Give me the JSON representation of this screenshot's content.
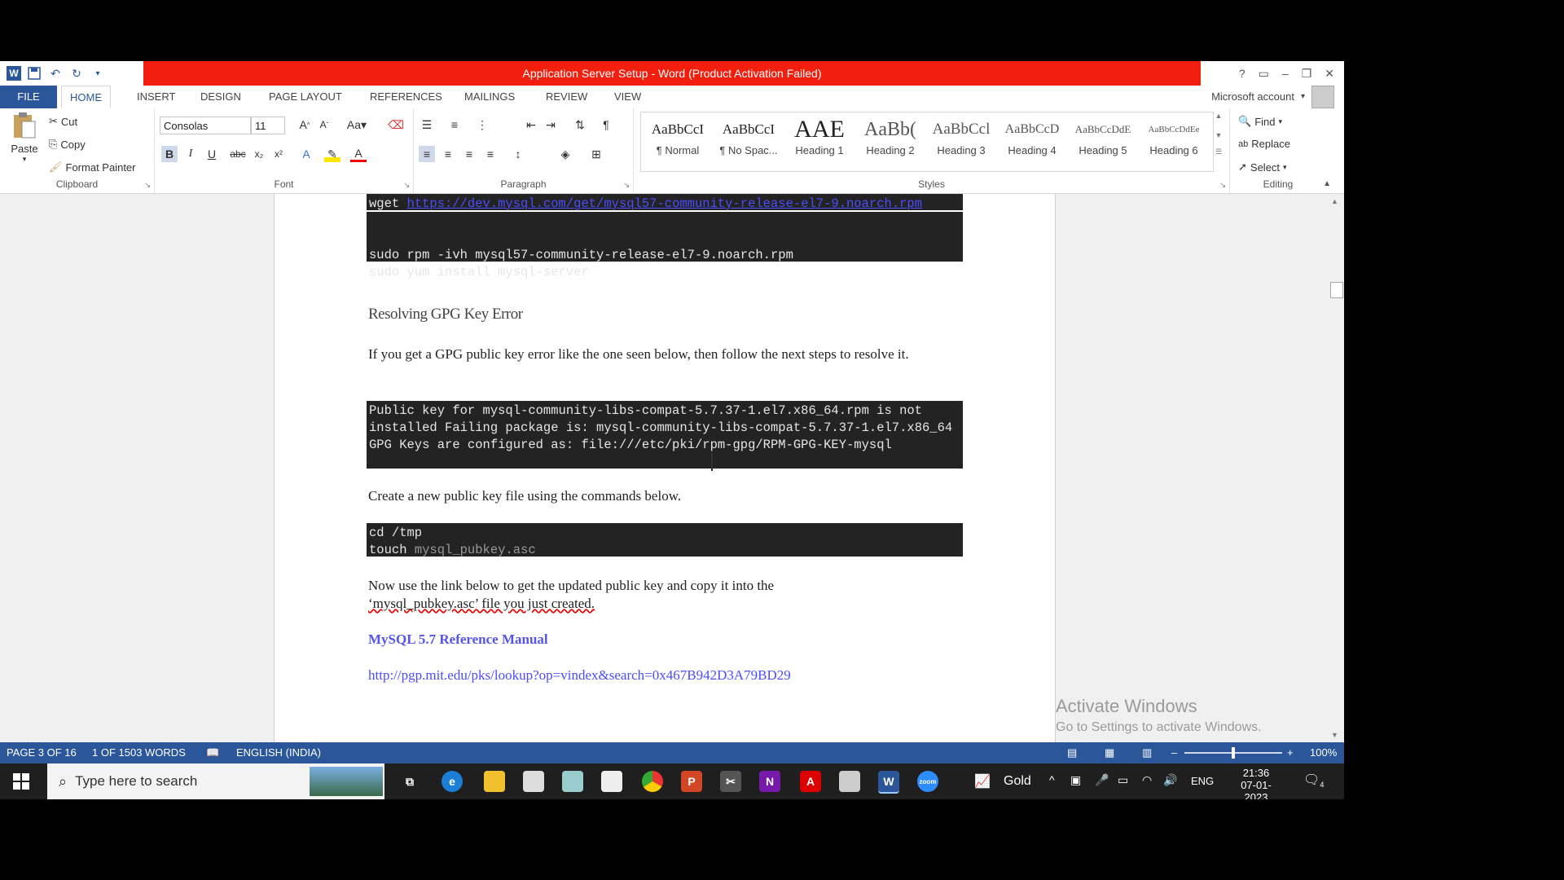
{
  "window": {
    "title": "Application Server Setup - Word (Product Activation Failed)",
    "controls": [
      "?",
      "▭",
      "–",
      "❐",
      "✕"
    ]
  },
  "tabs": [
    "FILE",
    "HOME",
    "INSERT",
    "DESIGN",
    "PAGE LAYOUT",
    "REFERENCES",
    "MAILINGS",
    "REVIEW",
    "VIEW"
  ],
  "account": "Microsoft account",
  "ribbon": {
    "clipboard": {
      "paste": "Paste",
      "cut": "Cut",
      "copy": "Copy",
      "format_painter": "Format Painter",
      "label": "Clipboard"
    },
    "font": {
      "family": "Consolas",
      "size": "11",
      "label": "Font"
    },
    "paragraph": {
      "label": "Paragraph"
    },
    "styles": {
      "label": "Styles",
      "items": [
        {
          "preview": "AaBbCcI",
          "name": "¶ Normal"
        },
        {
          "preview": "AaBbCcI",
          "name": "¶ No Spac..."
        },
        {
          "preview": "AAE",
          "name": "Heading 1"
        },
        {
          "preview": "AaBb(",
          "name": "Heading 2"
        },
        {
          "preview": "AaBbCcl",
          "name": "Heading 3"
        },
        {
          "preview": "AaBbCcD",
          "name": "Heading 4"
        },
        {
          "preview": "AaBbCcDdE",
          "name": "Heading 5"
        },
        {
          "preview": "AaBbCcDdEe",
          "name": "Heading 6"
        }
      ]
    },
    "editing": {
      "find": "Find",
      "replace": "Replace",
      "select": "Select",
      "label": "Editing"
    }
  },
  "document": {
    "code1_line1_cmd": "wget ",
    "code1_line1_url": "https://dev.mysql.com/get/mysql57-community-release-el7-9.noarch.rpm",
    "code1_line3": "sudo rpm -ivh mysql57-community-release-el7-9.noarch.rpm",
    "code1_line4": "sudo yum install mysql-server",
    "heading1": "Resolving GPG Key Error",
    "para1": "If you get a GPG public key error like the one seen below, then follow the next steps to resolve it.",
    "code2": "Public key for mysql-community-libs-compat-5.7.37-1.el7.x86_64.rpm is not installed Failing package is: mysql-community-libs-compat-5.7.37-1.el7.x86_64 GPG Keys are configured as: file:///etc/pki/rpm-gpg/RPM-GPG-KEY-mysql",
    "para2": "Create a new public key file using the commands below.",
    "code3_line1": "cd /tmp",
    "code3_line2_cmd": "touch ",
    "code3_line2_arg": "mysql_pubkey.asc",
    "para3_a": "Now use the link below to get the updated public key and copy it into the",
    "para3_b": "‘mysql_pubkey.asc’ file you just created.",
    "ref_link": "MySQL 5.7 Reference Manual",
    "url_link": "http://pgp.mit.edu/pks/lookup?op=vindex&search=0x467B942D3A79BD29"
  },
  "watermark": {
    "line1": "Activate Windows",
    "line2": "Go to Settings to activate Windows."
  },
  "status": {
    "page": "PAGE 3 OF 16",
    "words": "1 OF 1503 WORDS",
    "lang": "ENGLISH (INDIA)",
    "zoom": "100%"
  },
  "taskbar": {
    "search_placeholder": "Type here to search",
    "gold": "Gold",
    "lang": "ENG",
    "time": "21:36",
    "date": "07-01-2023",
    "notif_count": "4"
  }
}
